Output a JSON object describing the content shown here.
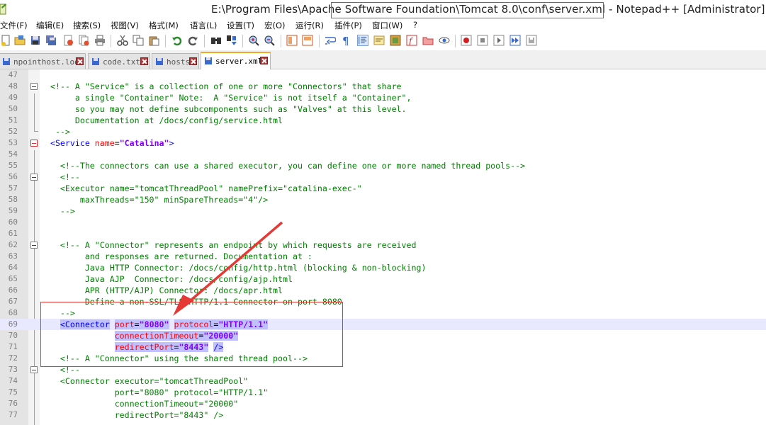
{
  "window": {
    "title": "E:\\Program Files\\Apache Software Foundation\\Tomcat 8.0\\conf\\server.xml - Notepad++ [Administrator]"
  },
  "menu": [
    {
      "label": "文件(F)",
      "name": "menu-file"
    },
    {
      "label": "编辑(E)",
      "name": "menu-edit"
    },
    {
      "label": "搜索(S)",
      "name": "menu-search"
    },
    {
      "label": "视图(V)",
      "name": "menu-view"
    },
    {
      "label": "格式(M)",
      "name": "menu-format"
    },
    {
      "label": "语言(L)",
      "name": "menu-language"
    },
    {
      "label": "设置(T)",
      "name": "menu-settings"
    },
    {
      "label": "宏(O)",
      "name": "menu-macro"
    },
    {
      "label": "运行(R)",
      "name": "menu-run"
    },
    {
      "label": "插件(P)",
      "name": "menu-plugins"
    },
    {
      "label": "窗口(W)",
      "name": "menu-window"
    },
    {
      "label": "?",
      "name": "menu-help"
    }
  ],
  "tabs": [
    {
      "label": "npointhost.look",
      "active": false
    },
    {
      "label": "code.txt",
      "active": false
    },
    {
      "label": "hosts",
      "active": false
    },
    {
      "label": "server.xml",
      "active": true
    }
  ],
  "colors": {
    "comment": "#008000",
    "tag": "#0000ff",
    "attribute": "#ff0000",
    "value": "#8000ff",
    "annotation": "#e53935",
    "current_line": "#e8e8ff"
  },
  "editor": {
    "current_line": 69,
    "lines": [
      {
        "n": "47",
        "text": ""
      },
      {
        "n": "48",
        "text": "  <!-- A \"Service\" is a collection of one or more \"Connectors\" that share"
      },
      {
        "n": "49",
        "text": "       a single \"Container\" Note:  A \"Service\" is not itself a \"Container\","
      },
      {
        "n": "50",
        "text": "       so you may not define subcomponents such as \"Valves\" at this level."
      },
      {
        "n": "51",
        "text": "       Documentation at /docs/config/service.html"
      },
      {
        "n": "52",
        "text": "   -->"
      },
      {
        "n": "53",
        "text": "  <Service name=\"Catalina\">"
      },
      {
        "n": "54",
        "text": ""
      },
      {
        "n": "55",
        "text": "    <!--The connectors can use a shared executor, you can define one or more named thread pools-->"
      },
      {
        "n": "56",
        "text": "    <!--"
      },
      {
        "n": "57",
        "text": "    <Executor name=\"tomcatThreadPool\" namePrefix=\"catalina-exec-\""
      },
      {
        "n": "58",
        "text": "        maxThreads=\"150\" minSpareThreads=\"4\"/>"
      },
      {
        "n": "59",
        "text": "    -->"
      },
      {
        "n": "60",
        "text": ""
      },
      {
        "n": "61",
        "text": ""
      },
      {
        "n": "62",
        "text": "    <!-- A \"Connector\" represents an endpoint by which requests are received"
      },
      {
        "n": "63",
        "text": "         and responses are returned. Documentation at :"
      },
      {
        "n": "64",
        "text": "         Java HTTP Connector: /docs/config/http.html (blocking & non-blocking)"
      },
      {
        "n": "65",
        "text": "         Java AJP  Connector: /docs/config/ajp.html"
      },
      {
        "n": "66",
        "text": "         APR (HTTP/AJP) Connector: /docs/apr.html"
      },
      {
        "n": "67",
        "text": "         Define a non-SSL/TLS HTTP/1.1 Connector on port 8080"
      },
      {
        "n": "68",
        "text": "    -->"
      },
      {
        "n": "69",
        "text": "    <Connector port=\"8080\" protocol=\"HTTP/1.1\""
      },
      {
        "n": "70",
        "text": "               connectionTimeout=\"20000\""
      },
      {
        "n": "71",
        "text": "               redirectPort=\"8443\" />"
      },
      {
        "n": "72",
        "text": "    <!-- A \"Connector\" using the shared thread pool-->"
      },
      {
        "n": "73",
        "text": "    <!--"
      },
      {
        "n": "74",
        "text": "    <Connector executor=\"tomcatThreadPool\""
      },
      {
        "n": "75",
        "text": "               port=\"8080\" protocol=\"HTTP/1.1\""
      },
      {
        "n": "76",
        "text": "               connectionTimeout=\"20000\""
      },
      {
        "n": "77",
        "text": "               redirectPort=\"8443\" />"
      }
    ]
  }
}
